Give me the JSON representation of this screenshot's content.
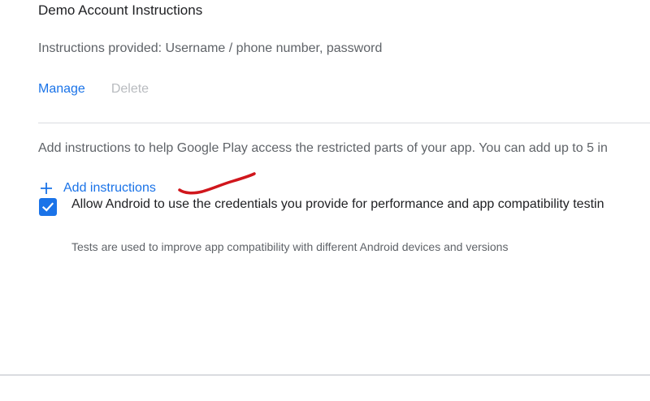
{
  "demo_account": {
    "title": "Demo Account Instructions",
    "instructions_provided": "Instructions provided: Username / phone number, password",
    "manage_label": "Manage",
    "delete_label": "Delete"
  },
  "help": {
    "text": "Add instructions to help Google Play access the restricted parts of your app. You can add up to 5 in"
  },
  "add_instructions": {
    "icon": "plus-icon",
    "label": "Add instructions"
  },
  "credentials": {
    "checked": true,
    "label": "Allow Android to use the credentials you provide for performance and app compatibility testin",
    "sublabel": "Tests are used to improve app compatibility with different Android devices and versions"
  },
  "colors": {
    "accent": "#1a73e8",
    "annotation": "#d0161c",
    "disabled": "#b8bbbf",
    "divider": "#dadce0"
  }
}
